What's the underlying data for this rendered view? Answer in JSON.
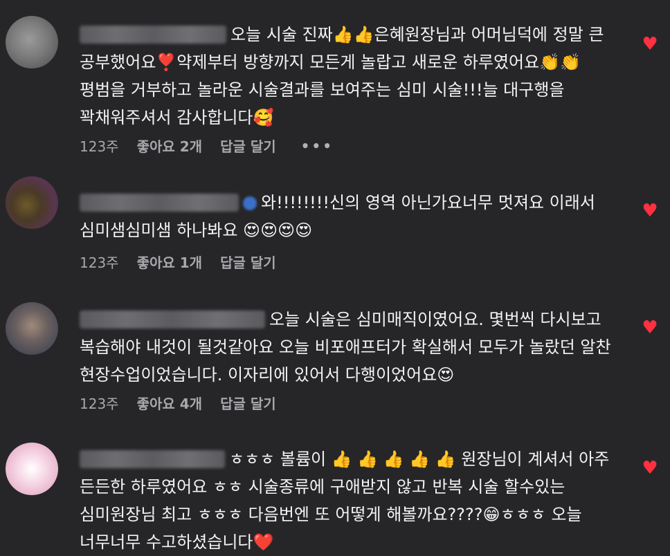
{
  "comments": [
    {
      "text": "오늘 시술 진짜👍👍은혜원장님과 어머님덕에 정말 큰 공부했어요❣️약제부터 방향까지 모든게 놀랍고 새로운 하루였어요👏👏평범을 거부하고 놀라운 시술결과를 보여주는 심미 시술!!!늘 대구행을 꽉채워주셔서 감사합니다🥰",
      "time": "123주",
      "likes": "좋아요 2개",
      "reply": "답글 달기",
      "more": "•••",
      "liked": true
    },
    {
      "text": "와!!!!!!!!신의 영역 아닌가요너무 멋져요 이래서 심미샘심미샘 하나봐요 😍😍😍😍",
      "time": "123주",
      "likes": "좋아요 1개",
      "reply": "답글 달기",
      "liked": true
    },
    {
      "text": "오늘 시술은 심미매직이였어요. 몇번씩 다시보고 복습해야 내것이 될것같아요 오늘 비포애프터가 확실해서 모두가 놀랐던 알찬 현장수업이었습니다. 이자리에 있어서 다행이었어요😍",
      "time": "123주",
      "likes": "좋아요 4개",
      "reply": "답글 달기",
      "liked": true
    },
    {
      "text": "ㅎㅎㅎ 볼륨이 👍 👍 👍 👍 👍 원장님이 계셔서 아주 든든한 하루였어요 ㅎㅎ 시술종류에 구애받지 않고 반복 시술 할수있는 심미원장님 최고 ㅎㅎㅎ 다음번엔 또 어떻게 해볼까요????😁ㅎㅎㅎ 오늘 너무너무 수고하셨습니다❤️",
      "liked": true
    }
  ],
  "icons": {
    "heart": "heart-icon",
    "more": "more-options-icon"
  },
  "colors": {
    "background": "#262628",
    "heart": "#ff3040",
    "meta": "#a8a8ad"
  }
}
